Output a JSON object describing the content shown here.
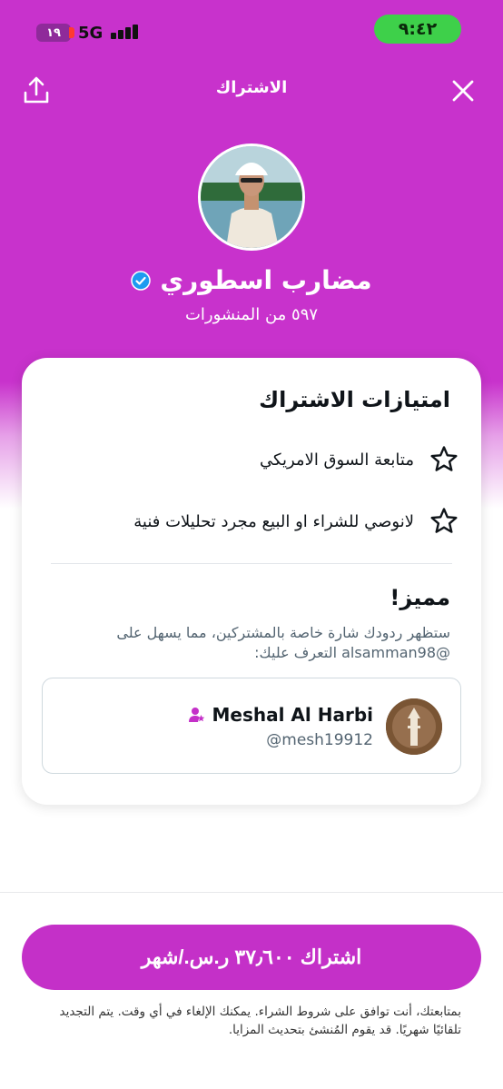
{
  "status": {
    "time": "٩:٤٢",
    "battery": "١٩",
    "network": "5G"
  },
  "nav": {
    "title": "الاشتراك"
  },
  "profile": {
    "name": "مضارب اسطوري",
    "posts": "٥٩٧ من المنشورات"
  },
  "perks": {
    "title": "امتيازات الاشتراك",
    "items": [
      {
        "icon": "star-icon",
        "text": "متابعة السوق الامريكي"
      },
      {
        "icon": "star-icon",
        "text": "لانوصي للشراء او البيع مجرد تحليلات فنية"
      }
    ]
  },
  "premium": {
    "title": "مميز!",
    "line1": "ستظهر ردودك شارة خاصة بالمشتركين، مما يسهل على",
    "line2": "@alsamman98 التعرف عليك:"
  },
  "preview": {
    "name": "Meshal Al Harbi",
    "handle": "@mesh19912"
  },
  "subscribe": {
    "label": "اشتراك ٣٧٫٦٠٠ ر.س./شهر"
  },
  "legal": {
    "line1": "بمتابعتك، أنت توافق على شروط الشراء. يمكنك الإلغاء في أي وقت. يتم التجديد",
    "line2": "تلقائيًا شهريًا. قد يقوم المُنشئ بتحديث المزايا."
  },
  "colors": {
    "brand": "#c832cc",
    "button": "#c430c8",
    "verified": "#1d9bf0",
    "status_pill": "#3ed04a"
  }
}
